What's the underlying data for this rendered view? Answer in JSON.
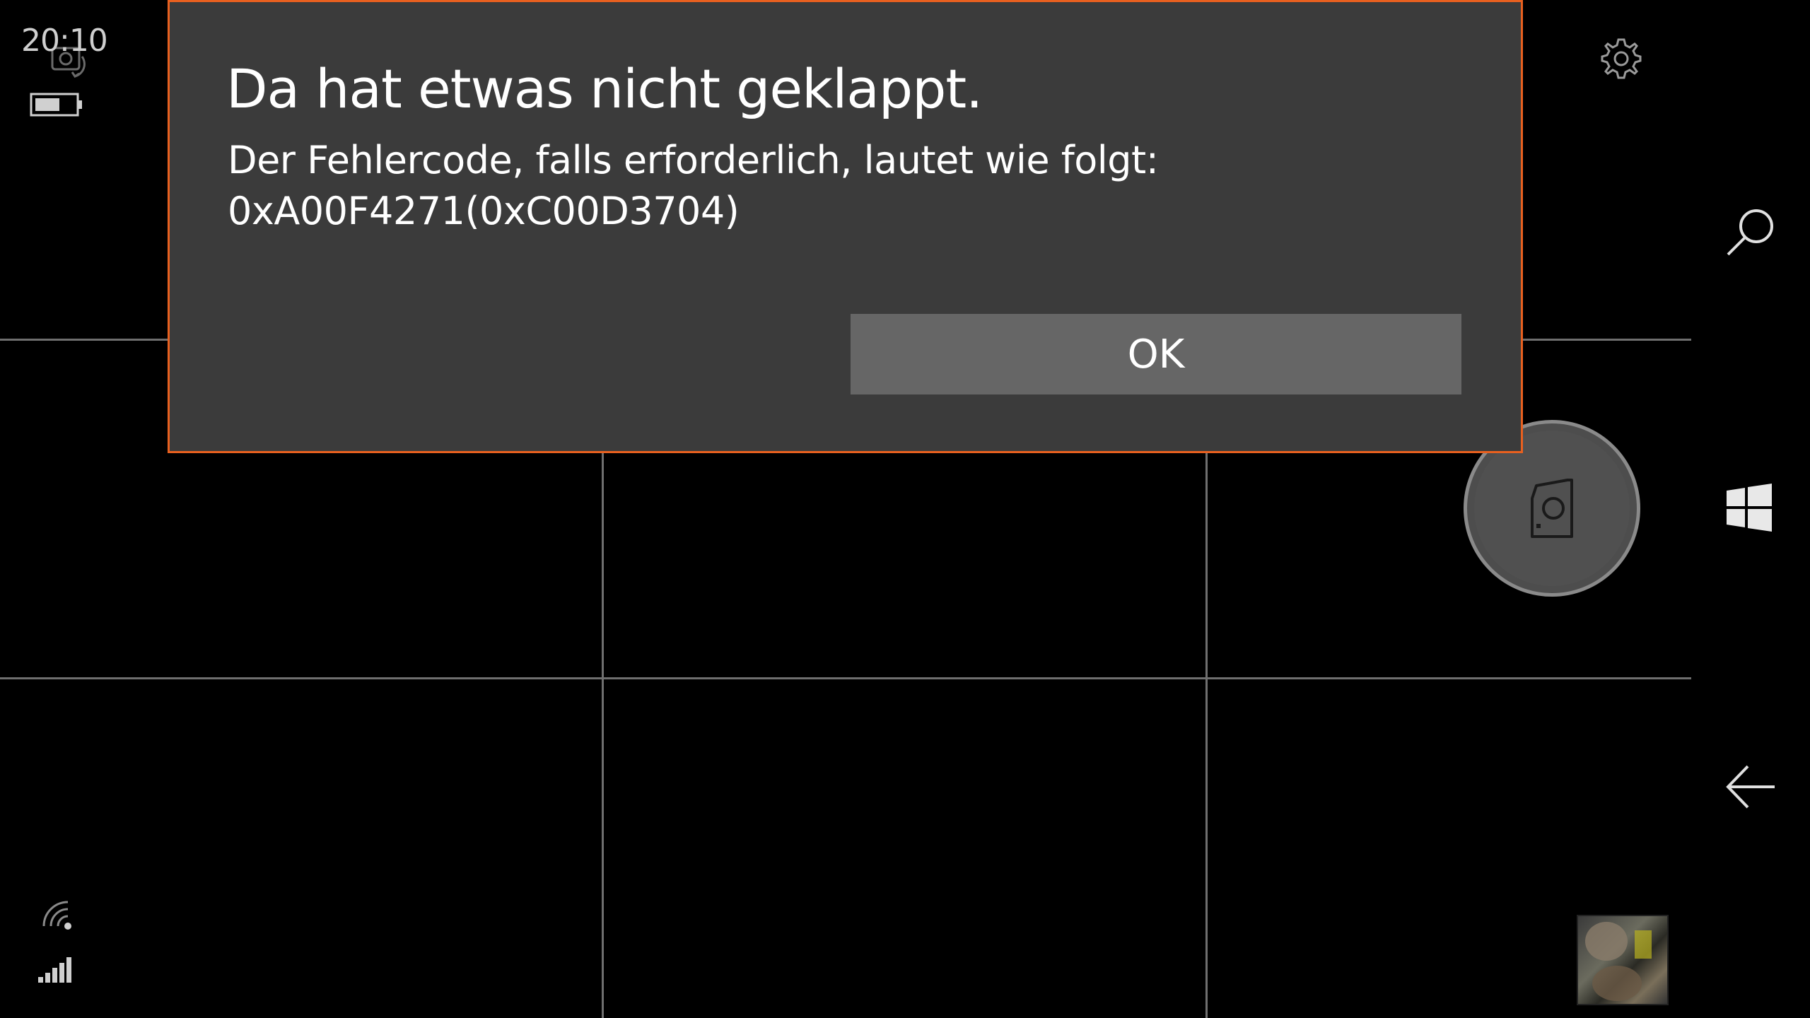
{
  "status_bar": {
    "time": "20:10",
    "icons": [
      "rotate-camera-icon",
      "battery-icon",
      "wifi-icon",
      "signal-icon"
    ]
  },
  "dialog": {
    "title": "Da hat etwas nicht geklappt.",
    "message_line1": "Der Fehlercode, falls erforderlich, lautet wie folgt:",
    "message_line2": "0xA00F4271(0xC00D3704)",
    "ok_label": "OK",
    "border_color": "#e8601f"
  },
  "right_rail": {
    "icons": [
      "settings-icon",
      "search-icon",
      "windows-icon",
      "back-icon"
    ]
  },
  "camera": {
    "shutter_icon": "camera-icon",
    "grid_overlay": true
  },
  "colors": {
    "background": "#000000",
    "dialog_background": "#3b3b3b",
    "button_background": "#666666",
    "accent": "#e8601f",
    "grid_line": "#6f6f6f"
  }
}
